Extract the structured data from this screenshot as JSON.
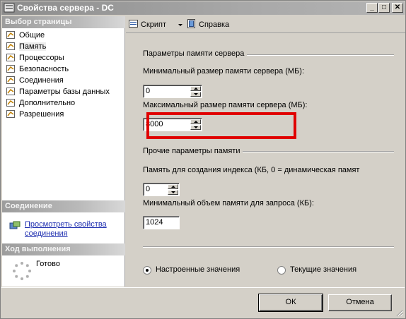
{
  "window": {
    "title": "Свойства сервера - DC",
    "buttons": {
      "minimize": "_",
      "maximize": "□",
      "close": "✕"
    }
  },
  "left": {
    "pages_header": "Выбор страницы",
    "pages": [
      {
        "label": "Общие",
        "icon": "page-icon",
        "selected": false
      },
      {
        "label": "Память",
        "icon": "page-icon",
        "selected": true
      },
      {
        "label": "Процессоры",
        "icon": "page-icon",
        "selected": false
      },
      {
        "label": "Безопасность",
        "icon": "page-icon",
        "selected": false
      },
      {
        "label": "Соединения",
        "icon": "page-icon",
        "selected": false
      },
      {
        "label": "Параметры базы данных",
        "icon": "page-icon",
        "selected": false
      },
      {
        "label": "Дополнительно",
        "icon": "page-icon",
        "selected": false
      },
      {
        "label": "Разрешения",
        "icon": "page-icon",
        "selected": false
      }
    ],
    "connection_header": "Соединение",
    "connection_link": "Просмотреть свойства соединения",
    "progress_header": "Ход выполнения",
    "progress_status": "Готово"
  },
  "toolbar": {
    "script_label": "Скрипт",
    "help_label": "Справка"
  },
  "memory": {
    "server_group_title": "Параметры памяти сервера",
    "min_label": "Минимальный размер памяти сервера (МБ):",
    "min_value": "0",
    "max_label": "Максимальный размер памяти сервера (МБ):",
    "max_value": "8000",
    "other_group_title": "Прочие параметры памяти",
    "index_label": "Память для создания индекса (КБ, 0 = динамическая памят",
    "index_value": "0",
    "query_label": "Минимальный объем памяти для запроса (КБ):",
    "query_value": "1024",
    "radio_configured": "Настроенные значения",
    "radio_running": "Текущие значения",
    "selected_radio": "configured"
  },
  "buttons": {
    "ok": "ОК",
    "cancel": "Отмена"
  },
  "colors": {
    "highlight": "#e00000",
    "link": "#1f2fb0"
  }
}
